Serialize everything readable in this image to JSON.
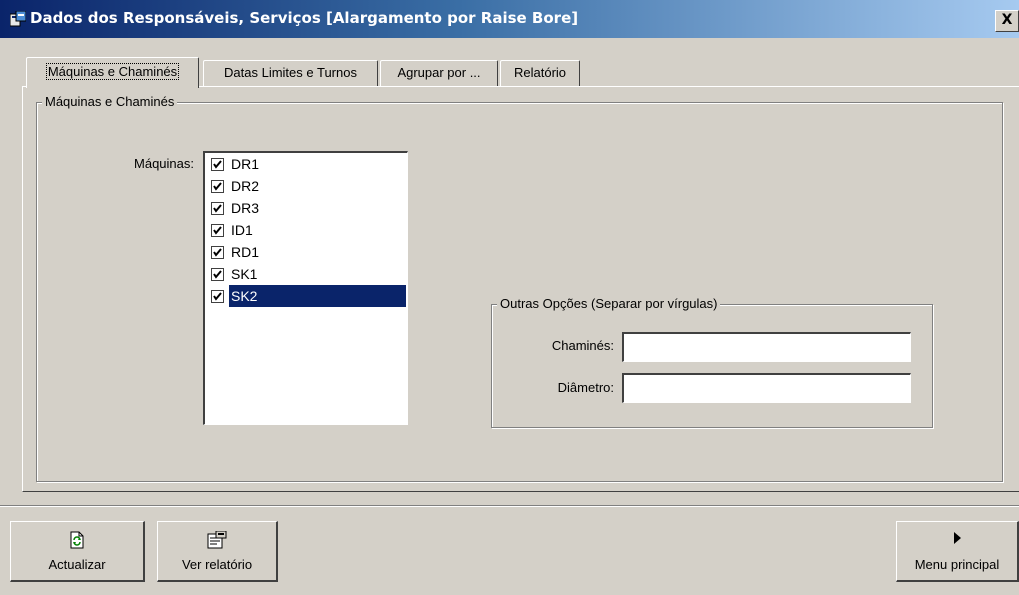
{
  "window": {
    "title": "Dados dos Responsáveis, Serviços [Alargamento por Raise Bore]",
    "close_label": "X"
  },
  "tabs": [
    {
      "label": "Máquinas e Chaminés",
      "active": true
    },
    {
      "label": "Datas Limites e Turnos",
      "active": false
    },
    {
      "label": "Agrupar por ...",
      "active": false
    },
    {
      "label": "Relatório",
      "active": false
    }
  ],
  "machines_group": {
    "legend": "Máquinas e Chaminés",
    "machines_label": "Máquinas:",
    "machines": [
      {
        "label": "DR1",
        "checked": true,
        "selected": false
      },
      {
        "label": "DR2",
        "checked": true,
        "selected": false
      },
      {
        "label": "DR3",
        "checked": true,
        "selected": false
      },
      {
        "label": "ID1",
        "checked": true,
        "selected": false
      },
      {
        "label": "RD1",
        "checked": true,
        "selected": false
      },
      {
        "label": "SK1",
        "checked": true,
        "selected": false
      },
      {
        "label": "SK2",
        "checked": true,
        "selected": true
      }
    ]
  },
  "other_options": {
    "legend": "Outras Opções (Separar por vírgulas)",
    "chimneys_label": "Chaminés:",
    "chimneys_value": "",
    "diameter_label": "Diâmetro:",
    "diameter_value": ""
  },
  "buttons": {
    "refresh": "Actualizar",
    "view_report": "Ver relatório",
    "main_menu": "Menu principal"
  },
  "colors": {
    "face": "#d4d0c8",
    "selection": "#0a246a",
    "title_gradient_start": "#0a246a",
    "title_gradient_end": "#a6caf0"
  }
}
